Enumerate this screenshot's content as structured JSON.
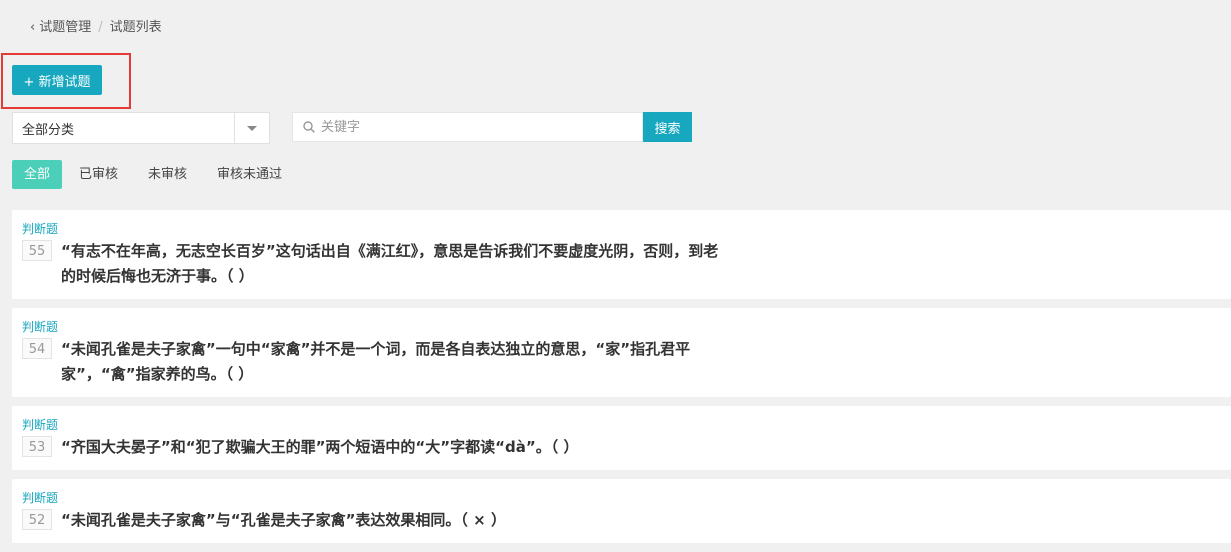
{
  "breadcrumb": {
    "back_icon": "chevron-left-icon",
    "parent": "试题管理",
    "separator": "/",
    "current": "试题列表"
  },
  "toolbar": {
    "add_label": "+ 新增试题"
  },
  "filter": {
    "category_selected": "全部分类",
    "search_placeholder": "关键字",
    "search_button": "搜索"
  },
  "tabs": [
    {
      "label": "全部",
      "active": true
    },
    {
      "label": "已审核",
      "active": false
    },
    {
      "label": "未审核",
      "active": false
    },
    {
      "label": "审核未通过",
      "active": false
    }
  ],
  "questions": [
    {
      "type": "判断题",
      "id": "55",
      "text": "“有志不在年高，无志空长百岁”这句话出自《满江红》，意思是告诉我们不要虚度光阴，否则，到老的时候后悔也无济于事。（ ）"
    },
    {
      "type": "判断题",
      "id": "54",
      "text": "“未闻孔雀是夫子家禽”一句中“家禽”并不是一个词，而是各自表达独立的意思，“家”指孔君平家”，“禽”指家养的鸟。（ ）"
    },
    {
      "type": "判断题",
      "id": "53",
      "text": "“齐国大夫晏子”和“犯了欺骗大王的罪”两个短语中的“大”字都读“dà”。（ ）"
    },
    {
      "type": "判断题",
      "id": "52",
      "text": "“未闻孔雀是夫子家禽”与“孔雀是夫子家禽”表达效果相同。（ × ）"
    }
  ],
  "colors": {
    "accent": "#17a7bf",
    "tab_active": "#4ccfb8",
    "highlight": "#e53935"
  }
}
